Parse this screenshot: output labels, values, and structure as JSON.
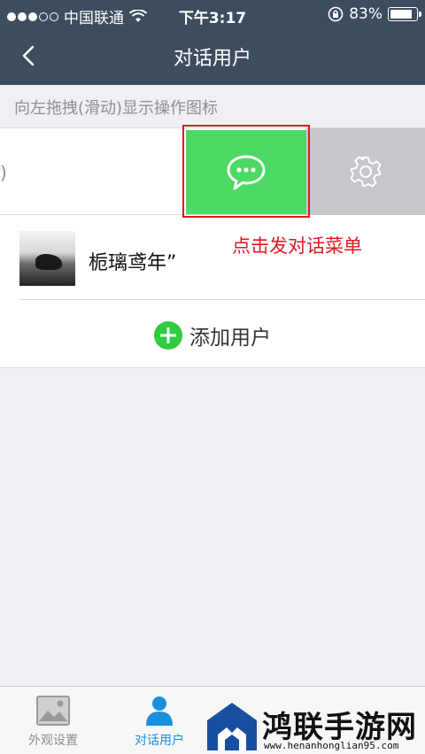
{
  "status_bar": {
    "carrier": "中国联通",
    "time": "下午3:17",
    "battery": "83%",
    "battery_level": 0.83
  },
  "nav": {
    "title": "对话用户",
    "back_icon": "chevron-left-icon"
  },
  "hint": "向左拖拽(滑动)显示操作图标",
  "rows": [
    {
      "partial_text": ")",
      "actions": [
        {
          "icon": "chat-bubble-icon",
          "color": "#4cd964"
        },
        {
          "icon": "gear-icon",
          "color": "#c7c7cc"
        }
      ]
    },
    {
      "name": "栀璃鸢年”"
    }
  ],
  "annotation": "点击发对话菜单",
  "add_user": "添加用户",
  "tabs": [
    {
      "label": "外观设置",
      "icon": "image-icon",
      "active": false
    },
    {
      "label": "对话用户",
      "icon": "user-icon",
      "active": true
    }
  ],
  "watermark": {
    "text": "鸿联手游网",
    "url": "www.henanhonglian95.com"
  },
  "colors": {
    "nav_bg": "#3d4d5f",
    "accent_green": "#4cd964",
    "annotation_red": "#e4161e",
    "active_tab": "#1a8fdc"
  }
}
